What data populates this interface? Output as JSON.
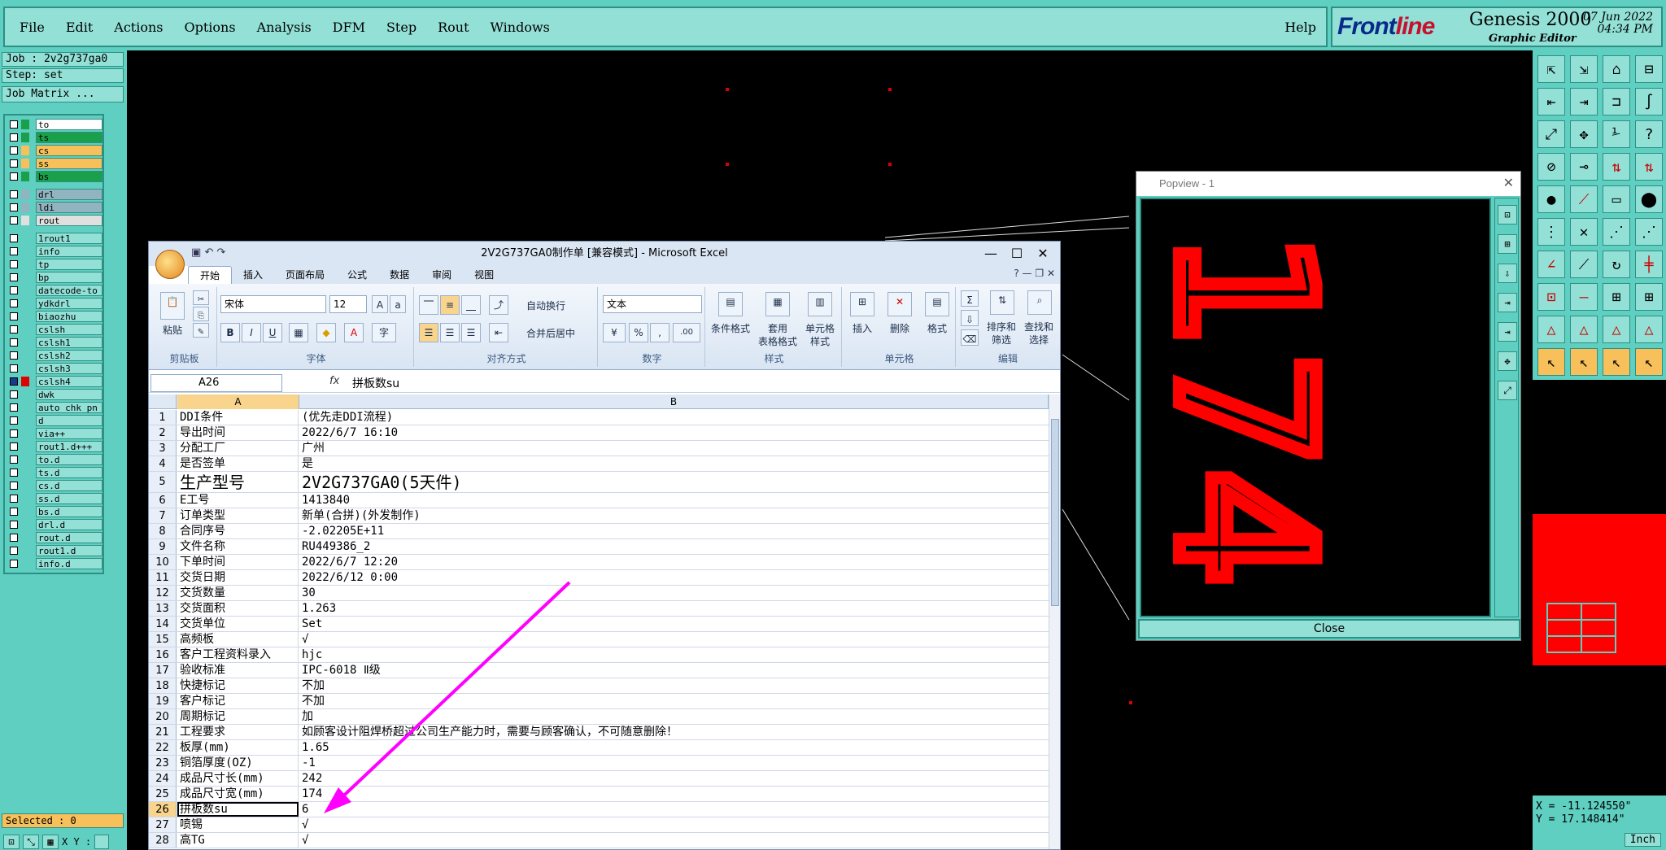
{
  "menubar": {
    "items": [
      "File",
      "Edit",
      "Actions",
      "Options",
      "Analysis",
      "DFM",
      "Step",
      "Rout",
      "Windows"
    ],
    "help": "Help"
  },
  "brand": {
    "logo_a": "Front",
    "logo_b": "line",
    "product": "Genesis 2000",
    "subtitle": "Graphic Editor",
    "date": "07 Jun 2022",
    "time": "04:34 PM"
  },
  "left": {
    "job": "Job : 2v2g737ga0",
    "step": "Step: set",
    "matrix_button": "Job Matrix ...",
    "selected": "Selected : 0",
    "xy_label": "X Y :",
    "layers": [
      {
        "name": "to",
        "color": "#1aa04a",
        "bg": "#ffffff"
      },
      {
        "name": "ts",
        "color": "#1aa04a",
        "bg": "#1aa04a"
      },
      {
        "name": "cs",
        "color": "#f7c05a",
        "bg": "#f7c05a"
      },
      {
        "name": "ss",
        "color": "#f7c05a",
        "bg": "#f7c05a"
      },
      {
        "name": "bs",
        "color": "#1aa04a",
        "bg": "#1aa04a"
      },
      {
        "name": "drl",
        "color": "#92b3c0",
        "bg": "#92b3c0"
      },
      {
        "name": "ldi",
        "color": "#92b3c0",
        "bg": "#92b3c0"
      },
      {
        "name": "rout",
        "color": "#e0e0e0",
        "bg": "#e0e0e0"
      },
      {
        "name": "1rout1",
        "color": "",
        "bg": ""
      },
      {
        "name": "info",
        "color": "",
        "bg": ""
      },
      {
        "name": "tp",
        "color": "",
        "bg": ""
      },
      {
        "name": "bp",
        "color": "",
        "bg": ""
      },
      {
        "name": "datecode-to",
        "color": "",
        "bg": ""
      },
      {
        "name": "ydkdrl",
        "color": "",
        "bg": ""
      },
      {
        "name": "biaozhu",
        "color": "",
        "bg": ""
      },
      {
        "name": "cslsh",
        "color": "",
        "bg": ""
      },
      {
        "name": "cslsh1",
        "color": "",
        "bg": ""
      },
      {
        "name": "cslsh2",
        "color": "",
        "bg": ""
      },
      {
        "name": "cslsh3",
        "color": "",
        "bg": ""
      },
      {
        "name": "cslsh4",
        "color": "#e00000",
        "bg": ""
      },
      {
        "name": "dwk",
        "color": "",
        "bg": ""
      },
      {
        "name": "auto_chk_pn",
        "color": "",
        "bg": ""
      },
      {
        "name": "d",
        "color": "",
        "bg": ""
      },
      {
        "name": "via++",
        "color": "",
        "bg": ""
      },
      {
        "name": "rout1.d+++",
        "color": "",
        "bg": ""
      },
      {
        "name": "to.d",
        "color": "",
        "bg": ""
      },
      {
        "name": "ts.d",
        "color": "",
        "bg": ""
      },
      {
        "name": "cs.d",
        "color": "",
        "bg": ""
      },
      {
        "name": "ss.d",
        "color": "",
        "bg": ""
      },
      {
        "name": "bs.d",
        "color": "",
        "bg": ""
      },
      {
        "name": "drl.d",
        "color": "",
        "bg": ""
      },
      {
        "name": "rout.d",
        "color": "",
        "bg": ""
      },
      {
        "name": "rout1.d",
        "color": "",
        "bg": ""
      },
      {
        "name": "info.d",
        "color": "",
        "bg": ""
      }
    ]
  },
  "popview": {
    "title": "Popview - 1",
    "close": "Close",
    "digits": "174"
  },
  "coords": {
    "x": "X = -11.124550\"",
    "y": "Y = 17.148414\""
  },
  "unit": "Inch",
  "excel": {
    "title": "2V2G737GA0制作单  [兼容模式] - Microsoft Excel",
    "tabs": [
      "开始",
      "插入",
      "页面布局",
      "公式",
      "数据",
      "审阅",
      "视图"
    ],
    "groups": {
      "clipboard": "剪贴板",
      "font": "字体",
      "align": "对齐方式",
      "number": "数字",
      "styles": "样式",
      "cells": "单元格",
      "edit": "编辑"
    },
    "ribbon": {
      "paste": "粘贴",
      "font_name": "宋体",
      "font_size": "12",
      "wrap": "自动换行",
      "merge": "合并后居中",
      "num_format": "文本",
      "cond_format": "条件格式",
      "table_format_a": "套用",
      "table_format_b": "表格格式",
      "cell_style_a": "单元格",
      "cell_style_b": "样式",
      "insert": "插入",
      "delete": "删除",
      "format": "格式",
      "sort_a": "排序和",
      "sort_b": "筛选",
      "find_a": "查找和",
      "find_b": "选择"
    },
    "namebox": "A26",
    "formula": "拼板数su",
    "col_a": "A",
    "col_b": "B",
    "rows": [
      {
        "n": "1",
        "a": "DDI条件",
        "b": "(优先走DDI流程)"
      },
      {
        "n": "2",
        "a": "导出时间",
        "b": "2022/6/7 16:10"
      },
      {
        "n": "3",
        "a": "分配工厂",
        "b": "广州"
      },
      {
        "n": "4",
        "a": "是否签单",
        "b": "是"
      },
      {
        "n": "5",
        "a": "生产型号",
        "b": "2V2G737GA0(5天件)"
      },
      {
        "n": "6",
        "a": "E工号",
        "b": "1413840"
      },
      {
        "n": "7",
        "a": "订单类型",
        "b": "新单(合拼)(外发制作)"
      },
      {
        "n": "8",
        "a": "合同序号",
        "b": "-2.02205E+11"
      },
      {
        "n": "9",
        "a": "文件名称",
        "b": "RU449386_2"
      },
      {
        "n": "10",
        "a": "下单时间",
        "b": "2022/6/7 12:20"
      },
      {
        "n": "11",
        "a": "交货日期",
        "b": "2022/6/12 0:00"
      },
      {
        "n": "12",
        "a": "交货数量",
        "b": "30"
      },
      {
        "n": "13",
        "a": "交货面积",
        "b": "1.263"
      },
      {
        "n": "14",
        "a": "交货单位",
        "b": "Set"
      },
      {
        "n": "15",
        "a": "高频板",
        "b": "√"
      },
      {
        "n": "16",
        "a": "客户工程资料录入",
        "b": "hjc"
      },
      {
        "n": "17",
        "a": "验收标准",
        "b": "IPC-6018 Ⅱ级"
      },
      {
        "n": "18",
        "a": "快捷标记",
        "b": "不加"
      },
      {
        "n": "19",
        "a": "客户标记",
        "b": "不加"
      },
      {
        "n": "20",
        "a": "周期标记",
        "b": "加"
      },
      {
        "n": "21",
        "a": "工程要求",
        "b": "如顾客设计阻焊桥超过公司生产能力时，需要与顾客确认，不可随意删除！"
      },
      {
        "n": "22",
        "a": "板厚(mm)",
        "b": "1.65"
      },
      {
        "n": "23",
        "a": "铜箔厚度(OZ)",
        "b": "-1"
      },
      {
        "n": "24",
        "a": "成品尺寸长(mm)",
        "b": "242"
      },
      {
        "n": "25",
        "a": "成品尺寸宽(mm)",
        "b": "174"
      },
      {
        "n": "26",
        "a": "拼板数su",
        "b": "6"
      },
      {
        "n": "27",
        "a": "喷锡",
        "b": "√"
      },
      {
        "n": "28",
        "a": "高TG",
        "b": "√"
      }
    ]
  },
  "colors": {
    "teal": "#5ecfc0",
    "teal_light": "#92e0d6",
    "arrow": "#ff00ff",
    "red": "#ff0000"
  }
}
